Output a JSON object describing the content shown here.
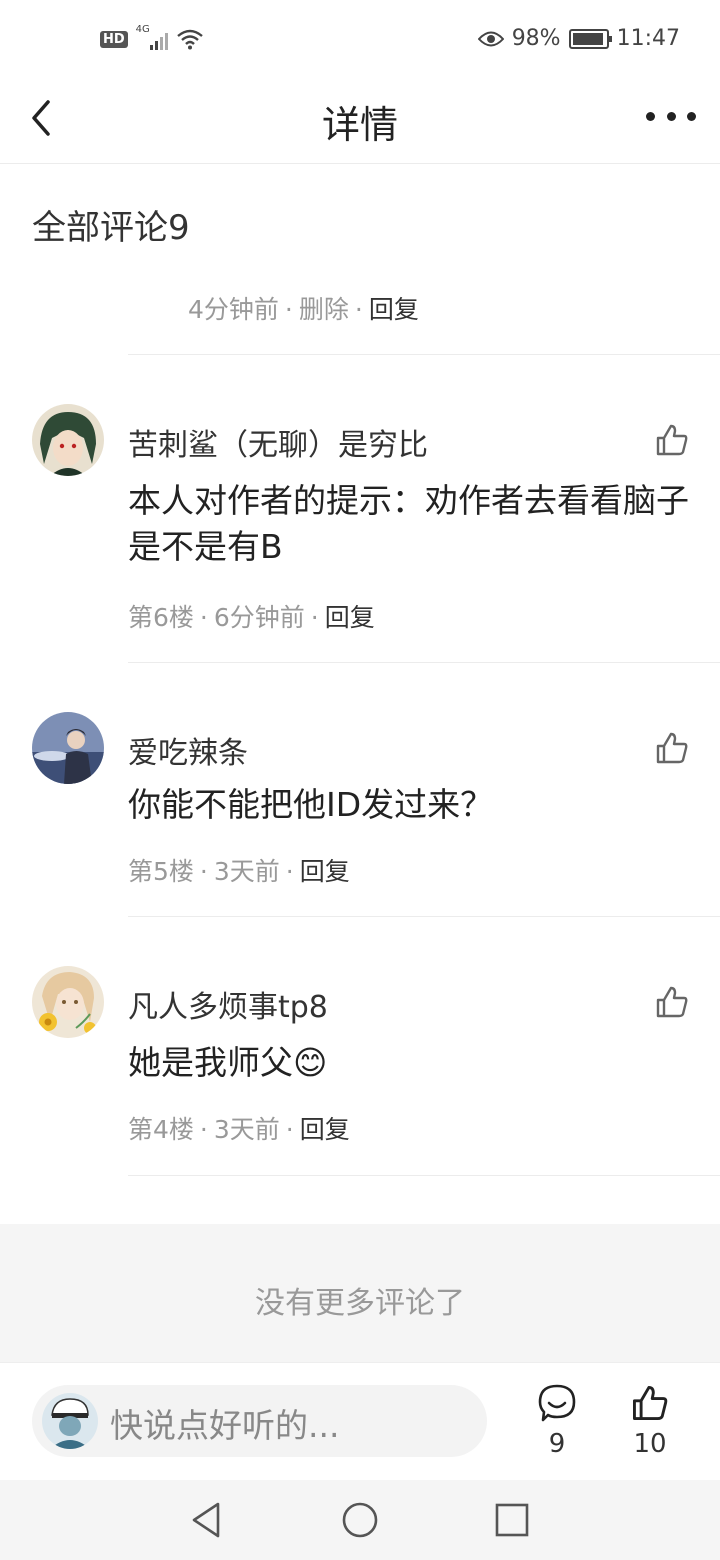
{
  "status_bar": {
    "hd": "HD",
    "network": "4G",
    "battery_percent": "98%",
    "time": "11:47"
  },
  "header": {
    "title": "详情"
  },
  "comments_section": {
    "title": "全部评论9",
    "orphan_meta": {
      "time": "4分钟前",
      "delete": "删除",
      "reply": "回复"
    },
    "comments": [
      {
        "username": "苦刺鲨（无聊）是穷比",
        "text": "本人对作者的提示：劝作者去看看脑子是不是有B",
        "floor": "第6楼",
        "time": "6分钟前",
        "reply": "回复"
      },
      {
        "username": "爱吃辣条",
        "text": "你能不能把他ID发过来？",
        "floor": "第5楼",
        "time": "3天前",
        "reply": "回复"
      },
      {
        "username": "凡人多烦事tp8",
        "text": "她是我师父😊",
        "floor": "第4楼",
        "time": "3天前",
        "reply": "回复"
      }
    ],
    "no_more": "没有更多评论了"
  },
  "bottom_bar": {
    "placeholder": "快说点好听的...",
    "comment_count": "9",
    "like_count": "10"
  },
  "colors": {
    "text_primary": "#222222",
    "text_secondary": "#999999",
    "divider": "#ececec",
    "footer_bg": "#f5f5f5"
  }
}
